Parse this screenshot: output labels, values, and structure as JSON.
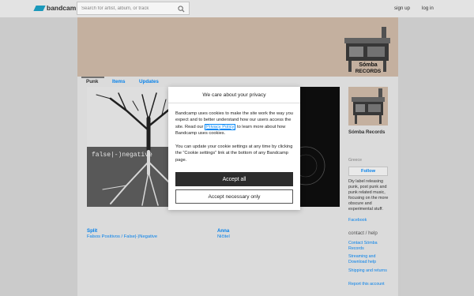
{
  "header": {
    "logo_text": "bandcamp",
    "search_placeholder": "Search for artist, album, or track",
    "signup": "sign up",
    "login": "log in"
  },
  "banner": {
    "art_text_line1": "Sómba",
    "art_text_line2": "RECORDS"
  },
  "tabs": [
    {
      "label": "Punk",
      "active": true
    },
    {
      "label": "Items",
      "active": false
    },
    {
      "label": "Updates",
      "active": false
    }
  ],
  "albums": [
    {
      "title": "Split",
      "artist": "Falsos Positivos / False|-)Negative",
      "cover_text": "false|-)negative"
    },
    {
      "title": "Anna",
      "artist": "Ničitel"
    }
  ],
  "sidebar": {
    "name": "Sómba Records",
    "location": "Greece",
    "follow": "Follow",
    "description": "Diy label releasing punk, post punk and punk related music, focusing on the more obscure and experimental stuff.",
    "facebook": "Facebook",
    "contact_heading": "contact / help",
    "links": [
      "Contact Sómba Records",
      "Streaming and Download help",
      "Shipping and returns",
      "Report this account"
    ]
  },
  "cookie_dialog": {
    "title": "We care about your privacy",
    "p1_before": "Bandcamp uses cookies to make the site work the way you expect and to better understand how our users access the site. Read our ",
    "p1_link": "Privacy Policy",
    "p1_after": " to learn more about how Bandcamp uses cookies.",
    "p2": "You can update your cookie settings at any time by clicking the “Cookie settings” link at the bottom of any Bandcamp page.",
    "accept_all": "Accept all",
    "accept_necessary": "Accept necessary only"
  },
  "colors": {
    "link_blue": "#0687f5",
    "brand_teal": "#1da0c3",
    "banner_bg": "#ccb8a6",
    "accept_bg": "#2d2d2d"
  }
}
